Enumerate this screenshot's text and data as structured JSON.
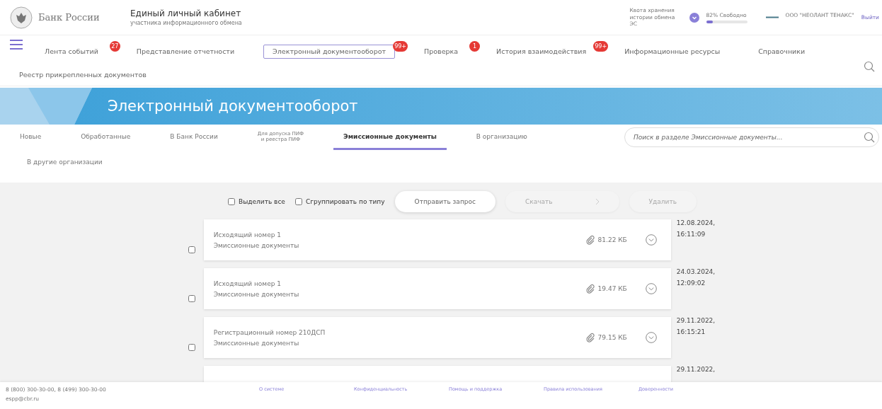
{
  "header": {
    "brand": "Банк России",
    "title": "Единый личный кабинет",
    "subtitle": "участника информационного обмена",
    "quota": {
      "label": "Квота хранения истории обмена ЭС",
      "reading": "82% Свободно",
      "level": 0.17
    },
    "org": "ООО \"НЕОЛАНТ ТЕНАКС\"",
    "logout": "Выйти"
  },
  "nav": [
    {
      "label": "Лента событий",
      "badge": "27",
      "selected": false
    },
    {
      "label": "Представление отчетности",
      "selected": false
    },
    {
      "label": "Электронный документооборот",
      "badge": "99+",
      "selected": true
    },
    {
      "label": "Проверка",
      "badge": "1",
      "selected": false
    },
    {
      "label": "История взаимодействия",
      "badge": "99+",
      "selected": false
    },
    {
      "label": "Информационные ресурсы",
      "selected": false
    },
    {
      "label": "Справочники",
      "selected": false
    },
    {
      "label": "Реестр прикрепленных документов",
      "selected": false
    }
  ],
  "banner": {
    "title": "Электронный документооборот"
  },
  "tabs": [
    {
      "label": "Новые",
      "selected": false
    },
    {
      "label": "Обработанные",
      "selected": false
    },
    {
      "label": "В Банк России",
      "selected": false
    },
    {
      "label": "Для допуска ПИФ\nи реестра ПИФ",
      "kind": "small",
      "selected": false
    },
    {
      "label": "Эмиссионные документы",
      "selected": true
    },
    {
      "label": "В организацию",
      "selected": false
    },
    {
      "label": "В другие организации",
      "selected": false
    }
  ],
  "search": {
    "placeholder": "Поиск в разделе Эмиссионные документы..."
  },
  "toolbar": {
    "select_all": {
      "label": "Выделить все",
      "checked": false
    },
    "group_by_type": {
      "label": "Сгруппировать по типу",
      "checked": false
    },
    "buttons": [
      {
        "label": "Отправить запрос",
        "disabled": false
      },
      {
        "label": "Скачать",
        "disabled": true,
        "kind": "arrow"
      },
      {
        "label": "Удалить",
        "disabled": true
      }
    ]
  },
  "documents": [
    {
      "title": "Исходящий номер 1",
      "type": "Эмиссионные документы",
      "size": "81.22 КБ",
      "date": "12.08.2024,",
      "time": "16:11:09",
      "checked": false
    },
    {
      "title": "Исходящий номер 1",
      "type": "Эмиссионные документы",
      "size": "19.47 КБ",
      "date": "24.03.2024,",
      "time": "12:09:02",
      "checked": false
    },
    {
      "title": "Регистрационный номер 210ДСП",
      "type": "Эмиссионные документы",
      "size": "79.15 КБ",
      "date": "29.11.2022,",
      "time": "16:15:21",
      "checked": false
    },
    {
      "date": "29.11.2022,"
    }
  ],
  "footer": {
    "phones": "8 (800) 300-30-00, 8 (499) 300-30-00",
    "email": "espp@cbr.ru",
    "links": [
      "О системе",
      "Конфиденциальность",
      "Помощь и поддержка",
      "Правила использования",
      "Доверенности"
    ]
  }
}
